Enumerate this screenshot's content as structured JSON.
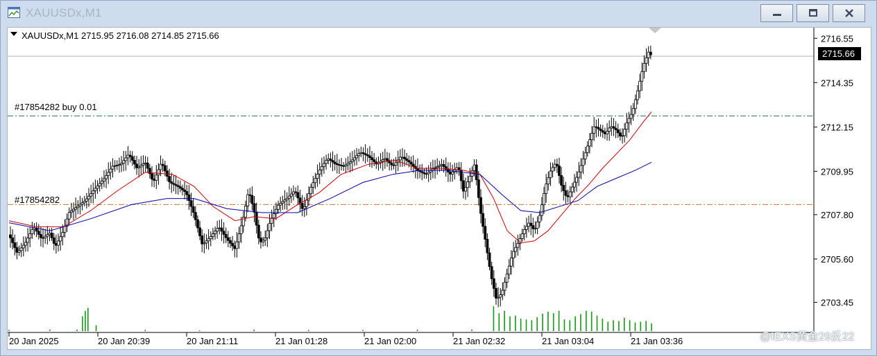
{
  "window": {
    "title": "XAUUSDx,M1",
    "controls": {
      "minimize": "minimize-icon",
      "restore": "restore-icon",
      "close": "close-icon"
    }
  },
  "chart": {
    "header": "XAUUSDx,M1  2715.95 2716.08 2714.85 2715.66",
    "current_price": "2715.66",
    "order_labels": {
      "buy_order": "#17854282 buy 0.01",
      "stop_order": "#17854282"
    },
    "colors": {
      "bull": "#000000",
      "ma_fast": "#cc0000",
      "ma_slow": "#0000aa",
      "buy_line": "#1f7a3a",
      "stop_line": "#d4762a",
      "volume": "#109a10"
    }
  },
  "watermark": "@IEXS黄金29反22",
  "chart_data": {
    "type": "candlestick",
    "symbol": "XAUUSDx",
    "timeframe": "M1",
    "ohlc_last": {
      "open": 2715.95,
      "high": 2716.08,
      "low": 2714.85,
      "close": 2715.66
    },
    "ylim": [
      2702.3,
      2716.8
    ],
    "y_ticks": [
      "2716.55",
      "2714.35",
      "2712.15",
      "2709.95",
      "2707.80",
      "2705.60",
      "2703.45"
    ],
    "x_ticks": [
      "20 Jan 2025",
      "20 Jan 20:39",
      "20 Jan 21:11",
      "21 Jan 01:28",
      "21 Jan 02:00",
      "21 Jan 02:32",
      "21 Jan 03:04",
      "21 Jan 03:36"
    ],
    "price_lines": [
      {
        "label": "#17854282 buy 0.01",
        "price": 2712.7,
        "style": "dash-dot",
        "color": "#1f7a3a"
      },
      {
        "label": "#17854282",
        "price": 2708.3,
        "style": "dash-dot",
        "color": "#d4762a"
      },
      {
        "label": "2715.66",
        "price": 2715.66,
        "style": "solid",
        "color": "#b0b0b0"
      }
    ],
    "close_path": [
      [
        0,
        2706.8
      ],
      [
        6,
        2705.9
      ],
      [
        12,
        2706.4
      ],
      [
        18,
        2707.2
      ],
      [
        24,
        2706.6
      ],
      [
        30,
        2706.9
      ],
      [
        34,
        2706.2
      ],
      [
        40,
        2707.0
      ],
      [
        44,
        2707.9
      ],
      [
        50,
        2708.2
      ],
      [
        56,
        2708.5
      ],
      [
        62,
        2709.0
      ],
      [
        70,
        2709.6
      ],
      [
        76,
        2710.2
      ],
      [
        82,
        2710.3
      ],
      [
        88,
        2710.8
      ],
      [
        94,
        2710.1
      ],
      [
        100,
        2710.4
      ],
      [
        106,
        2709.4
      ],
      [
        112,
        2710.4
      ],
      [
        118,
        2709.4
      ],
      [
        124,
        2709.2
      ],
      [
        130,
        2708.9
      ],
      [
        136,
        2707.8
      ],
      [
        142,
        2706.3
      ],
      [
        148,
        2706.7
      ],
      [
        154,
        2707.2
      ],
      [
        160,
        2706.6
      ],
      [
        166,
        2706.1
      ],
      [
        172,
        2707.6
      ],
      [
        176,
        2709.0
      ],
      [
        180,
        2708.0
      ],
      [
        184,
        2706.4
      ],
      [
        188,
        2706.6
      ],
      [
        192,
        2707.5
      ],
      [
        198,
        2708.3
      ],
      [
        204,
        2708.6
      ],
      [
        210,
        2709.0
      ],
      [
        216,
        2708.0
      ],
      [
        222,
        2709.2
      ],
      [
        228,
        2710.0
      ],
      [
        234,
        2710.6
      ],
      [
        240,
        2710.3
      ],
      [
        246,
        2710.2
      ],
      [
        252,
        2710.5
      ],
      [
        258,
        2710.9
      ],
      [
        264,
        2710.7
      ],
      [
        270,
        2710.3
      ],
      [
        276,
        2710.6
      ],
      [
        282,
        2710.2
      ],
      [
        288,
        2710.7
      ],
      [
        294,
        2710.4
      ],
      [
        300,
        2710.0
      ],
      [
        306,
        2709.8
      ],
      [
        312,
        2710.1
      ],
      [
        318,
        2710.3
      ],
      [
        324,
        2709.8
      ],
      [
        330,
        2710.2
      ],
      [
        334,
        2708.9
      ],
      [
        338,
        2709.6
      ],
      [
        342,
        2710.3
      ],
      [
        346,
        2708.1
      ],
      [
        350,
        2706.5
      ],
      [
        354,
        2704.8
      ],
      [
        358,
        2703.6
      ],
      [
        362,
        2703.9
      ],
      [
        366,
        2704.9
      ],
      [
        370,
        2705.9
      ],
      [
        374,
        2706.4
      ],
      [
        378,
        2707.0
      ],
      [
        382,
        2707.4
      ],
      [
        386,
        2707.0
      ],
      [
        390,
        2707.8
      ],
      [
        394,
        2709.2
      ],
      [
        398,
        2710.0
      ],
      [
        402,
        2710.4
      ],
      [
        406,
        2709.2
      ],
      [
        410,
        2708.6
      ],
      [
        414,
        2709.2
      ],
      [
        418,
        2709.8
      ],
      [
        422,
        2710.6
      ],
      [
        426,
        2711.4
      ],
      [
        430,
        2712.2
      ],
      [
        434,
        2712.0
      ],
      [
        438,
        2711.8
      ],
      [
        442,
        2712.2
      ],
      [
        446,
        2712.0
      ],
      [
        450,
        2711.6
      ],
      [
        454,
        2712.4
      ],
      [
        458,
        2712.9
      ],
      [
        462,
        2714.0
      ],
      [
        466,
        2715.2
      ],
      [
        470,
        2715.9
      ],
      [
        472,
        2715.66
      ]
    ],
    "ma_fast": [
      [
        0,
        2707.5
      ],
      [
        20,
        2707.2
      ],
      [
        40,
        2707.2
      ],
      [
        60,
        2708.0
      ],
      [
        80,
        2709.0
      ],
      [
        100,
        2709.9
      ],
      [
        120,
        2709.8
      ],
      [
        136,
        2709.2
      ],
      [
        150,
        2708.2
      ],
      [
        166,
        2707.5
      ],
      [
        180,
        2707.7
      ],
      [
        196,
        2707.6
      ],
      [
        212,
        2708.3
      ],
      [
        228,
        2708.9
      ],
      [
        244,
        2709.8
      ],
      [
        264,
        2710.3
      ],
      [
        284,
        2710.5
      ],
      [
        300,
        2710.1
      ],
      [
        318,
        2710.1
      ],
      [
        334,
        2710.0
      ],
      [
        346,
        2709.8
      ],
      [
        356,
        2708.6
      ],
      [
        366,
        2707.0
      ],
      [
        376,
        2706.4
      ],
      [
        386,
        2706.5
      ],
      [
        396,
        2707.0
      ],
      [
        406,
        2707.8
      ],
      [
        416,
        2708.6
      ],
      [
        426,
        2709.3
      ],
      [
        436,
        2710.1
      ],
      [
        446,
        2710.8
      ],
      [
        456,
        2711.5
      ],
      [
        466,
        2712.4
      ],
      [
        472,
        2712.9
      ]
    ],
    "ma_slow": [
      [
        0,
        2707.4
      ],
      [
        30,
        2707.0
      ],
      [
        60,
        2707.6
      ],
      [
        90,
        2708.3
      ],
      [
        116,
        2708.6
      ],
      [
        136,
        2708.6
      ],
      [
        160,
        2708.1
      ],
      [
        186,
        2707.9
      ],
      [
        212,
        2707.9
      ],
      [
        236,
        2708.6
      ],
      [
        260,
        2709.4
      ],
      [
        282,
        2709.8
      ],
      [
        302,
        2710.0
      ],
      [
        322,
        2710.0
      ],
      [
        346,
        2709.8
      ],
      [
        362,
        2708.8
      ],
      [
        376,
        2708.0
      ],
      [
        390,
        2707.9
      ],
      [
        404,
        2708.2
      ],
      [
        418,
        2708.5
      ],
      [
        432,
        2709.2
      ],
      [
        446,
        2709.6
      ],
      [
        460,
        2710.0
      ],
      [
        472,
        2710.4
      ]
    ],
    "volume": [
      [
        0,
        0.03
      ],
      [
        30,
        0.04
      ],
      [
        50,
        0.04
      ],
      [
        54,
        0.38
      ],
      [
        56,
        0.52
      ],
      [
        58,
        0.6
      ],
      [
        64,
        0.15
      ],
      [
        100,
        0.03
      ],
      [
        140,
        0.02
      ],
      [
        180,
        0.04
      ],
      [
        220,
        0.03
      ],
      [
        260,
        0.03
      ],
      [
        300,
        0.04
      ],
      [
        340,
        0.04
      ],
      [
        356,
        0.64
      ],
      [
        360,
        0.46
      ],
      [
        364,
        0.52
      ],
      [
        368,
        0.38
      ],
      [
        372,
        0.4
      ],
      [
        376,
        0.32
      ],
      [
        380,
        0.3
      ],
      [
        384,
        0.28
      ],
      [
        388,
        0.36
      ],
      [
        392,
        0.45
      ],
      [
        396,
        0.5
      ],
      [
        400,
        0.46
      ],
      [
        404,
        0.52
      ],
      [
        408,
        0.3
      ],
      [
        412,
        0.28
      ],
      [
        416,
        0.38
      ],
      [
        420,
        0.44
      ],
      [
        424,
        0.52
      ],
      [
        428,
        0.5
      ],
      [
        432,
        0.4
      ],
      [
        436,
        0.32
      ],
      [
        440,
        0.24
      ],
      [
        444,
        0.28
      ],
      [
        448,
        0.26
      ],
      [
        452,
        0.34
      ],
      [
        456,
        0.28
      ],
      [
        460,
        0.22
      ],
      [
        464,
        0.24
      ],
      [
        468,
        0.26
      ],
      [
        472,
        0.2
      ]
    ]
  }
}
